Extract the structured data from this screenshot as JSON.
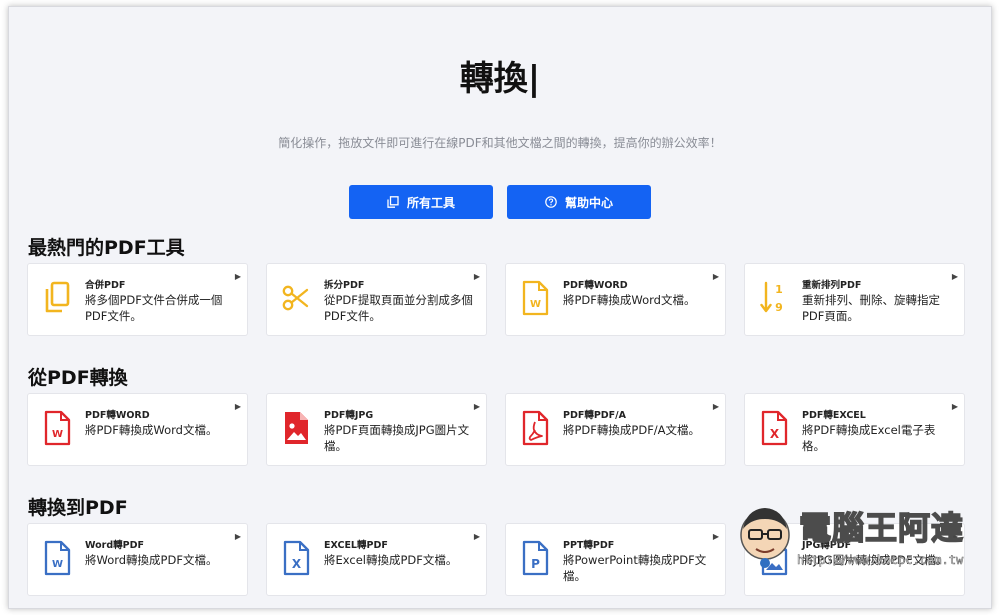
{
  "hero": {
    "title": "轉換|",
    "subtitle": "簡化操作，拖放文件即可進行在線PDF和其他文檔之間的轉換，提高你的辦公效率！",
    "buttons": [
      {
        "label": "所有工具",
        "icon": "copy-icon"
      },
      {
        "label": "幫助中心",
        "icon": "help-circle-icon"
      }
    ]
  },
  "colors": {
    "accent": "#1463f3",
    "pdf_red": "#e0262b",
    "word_blue": "#3a6fc4",
    "popular_yellow": "#f2b51f",
    "background": "#f3f4f8"
  },
  "sections": [
    {
      "title": "最熱門的PDF工具",
      "cards": [
        {
          "title": "合併PDF",
          "desc": "將多個PDF文件合併成一個PDF文件。",
          "icon": "merge-pages-icon"
        },
        {
          "title": "拆分PDF",
          "desc": "從PDF提取頁面並分割成多個PDF文件。",
          "icon": "scissors-icon"
        },
        {
          "title": "PDF轉WORD",
          "desc": "將PDF轉換成Word文檔。",
          "icon": "word-file-icon"
        },
        {
          "title": "重新排列PDF",
          "desc": "重新排列、刪除、旋轉指定PDF頁面。",
          "icon": "sort-numbers-icon"
        }
      ]
    },
    {
      "title": "從PDF轉換",
      "cards": [
        {
          "title": "PDF轉WORD",
          "desc": "將PDF轉換成Word文檔。",
          "icon": "word-file-icon"
        },
        {
          "title": "PDF轉JPG",
          "desc": "將PDF頁面轉換成JPG圖片文檔。",
          "icon": "image-file-icon"
        },
        {
          "title": "PDF轉PDF/A",
          "desc": "將PDF轉換成PDF/A文檔。",
          "icon": "pdfa-file-icon"
        },
        {
          "title": "PDF轉EXCEL",
          "desc": "將PDF轉換成Excel電子表格。",
          "icon": "excel-file-icon"
        }
      ]
    },
    {
      "title": "轉換到PDF",
      "cards": [
        {
          "title": "Word轉PDF",
          "desc": "將Word轉換成PDF文檔。",
          "icon": "word-file-icon"
        },
        {
          "title": "EXCEL轉PDF",
          "desc": "將Excel轉換成PDF文檔。",
          "icon": "excel-file-icon"
        },
        {
          "title": "PPT轉PDF",
          "desc": "將PowerPoint轉換成PDF文檔。",
          "icon": "ppt-file-icon"
        },
        {
          "title": "JPG轉PDF",
          "desc": "將JPG圖片轉換成PDF文檔。",
          "icon": "image-file-icon"
        }
      ]
    }
  ],
  "watermark": {
    "text": "電腦王阿達",
    "url": "http://www.kocpc.com.tw"
  }
}
